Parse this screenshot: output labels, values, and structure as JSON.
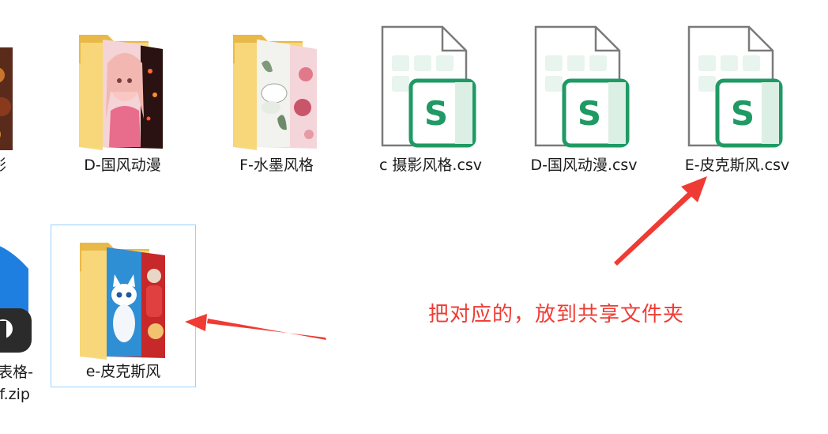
{
  "items": [
    {
      "label": "影",
      "type": "folder"
    },
    {
      "label": "D-国风动漫",
      "type": "folder"
    },
    {
      "label": "F-水墨风格",
      "type": "folder"
    },
    {
      "label": "c 摄影风格.csv",
      "type": "csv"
    },
    {
      "label": "D-国风动漫.csv",
      "type": "csv"
    },
    {
      "label": "E-皮克斯风.csv",
      "type": "csv"
    },
    {
      "label_line1": "表格-",
      "label_line2": "f.zip",
      "type": "zip"
    },
    {
      "label": "e-皮克斯风",
      "type": "folder",
      "selected": true
    }
  ],
  "csv_badge_letter": "S",
  "annotation_text": "把对应的，放到共享文件夹",
  "colors": {
    "folder_yellow": "#f7d77a",
    "csv_green": "#1f9a64",
    "annotation_red": "#ef3b33",
    "selection_border": "#99d1ff"
  }
}
